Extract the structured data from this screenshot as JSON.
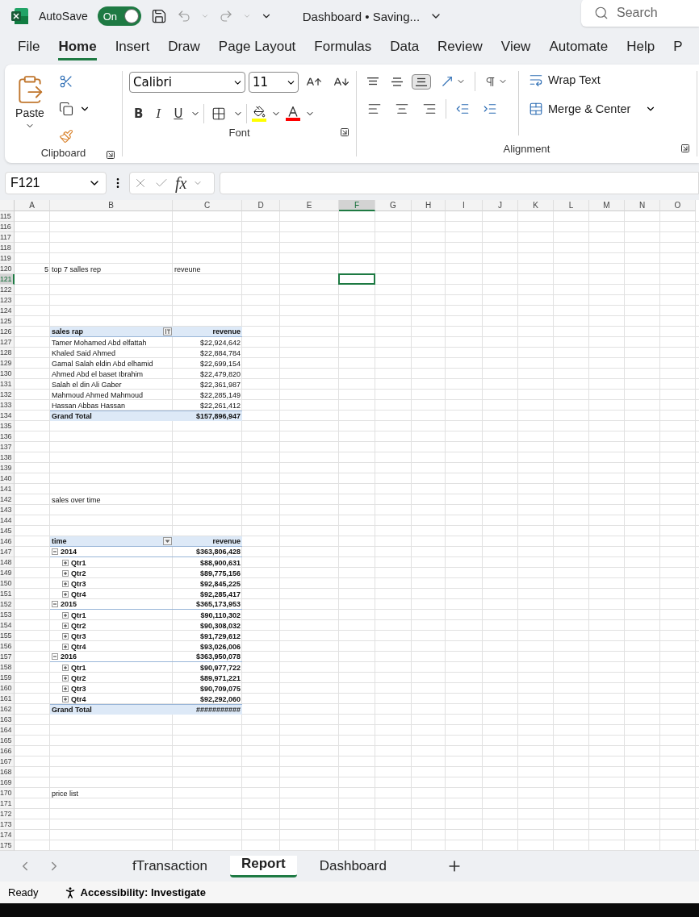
{
  "title_bar": {
    "autosave_label": "AutoSave",
    "autosave": {
      "label": "On",
      "on": true
    },
    "title": "Dashboard • Saving...",
    "search_placeholder": "Search"
  },
  "ribbon_tabs": [
    {
      "label": "File",
      "selected": false
    },
    {
      "label": "Home",
      "selected": true
    },
    {
      "label": "Insert",
      "selected": false
    },
    {
      "label": "Draw",
      "selected": false
    },
    {
      "label": "Page Layout",
      "selected": false
    },
    {
      "label": "Formulas",
      "selected": false
    },
    {
      "label": "Data",
      "selected": false
    },
    {
      "label": "Review",
      "selected": false
    },
    {
      "label": "View",
      "selected": false
    },
    {
      "label": "Automate",
      "selected": false
    },
    {
      "label": "Help",
      "selected": false
    },
    {
      "label": "P",
      "selected": false
    }
  ],
  "ribbon": {
    "paste_label": "Paste",
    "font_name": "Calibri",
    "font_size": "11",
    "format_buttons": [
      "B",
      "I",
      "U"
    ],
    "vertical_align": [
      {
        "kind": "top",
        "selected": false
      },
      {
        "kind": "middle",
        "selected": false
      },
      {
        "kind": "bottom",
        "selected": true
      }
    ],
    "wrap_text": "Wrap Text",
    "merge": "Merge & Center",
    "groups": [
      {
        "label": "Clipboard"
      },
      {
        "label": "Font"
      },
      {
        "label": "Alignment"
      }
    ]
  },
  "formula_bar": {
    "name_box": "F121",
    "function_label": "fx"
  },
  "columns": [
    {
      "label": "A",
      "selected": false
    },
    {
      "label": "B",
      "selected": false
    },
    {
      "label": "C",
      "selected": false
    },
    {
      "label": "D",
      "selected": false
    },
    {
      "label": "E",
      "selected": false
    },
    {
      "label": "F",
      "selected": true
    },
    {
      "label": "G",
      "selected": false
    },
    {
      "label": "H",
      "selected": false
    },
    {
      "label": "I",
      "selected": false
    },
    {
      "label": "J",
      "selected": false
    },
    {
      "label": "K",
      "selected": false
    },
    {
      "label": "L",
      "selected": false
    },
    {
      "label": "M",
      "selected": false
    },
    {
      "label": "N",
      "selected": false
    },
    {
      "label": "O",
      "selected": false
    }
  ],
  "rows": [
    {
      "number": "115",
      "kind": "plain",
      "selected": false
    },
    {
      "number": "116",
      "kind": "plain",
      "selected": false
    },
    {
      "number": "117",
      "kind": "plain",
      "selected": false
    },
    {
      "number": "118",
      "kind": "plain",
      "selected": false
    },
    {
      "number": "119",
      "kind": "plain",
      "selected": false
    },
    {
      "number": "120",
      "kind": "plain",
      "selected": false,
      "a": "5",
      "b": "top 7 salles rep",
      "c": "reveune"
    },
    {
      "number": "121",
      "kind": "plain",
      "selected": true
    },
    {
      "number": "122",
      "kind": "plain",
      "selected": false
    },
    {
      "number": "123",
      "kind": "plain",
      "selected": false
    },
    {
      "number": "124",
      "kind": "plain",
      "selected": false
    },
    {
      "number": "125",
      "kind": "plain",
      "selected": false
    },
    {
      "number": "126",
      "kind": "pivot_header",
      "selected": false,
      "label": "sales rap",
      "value": "revenue",
      "filter": {
        "kind": "sorted"
      }
    },
    {
      "number": "127",
      "kind": "pivot_item",
      "selected": false,
      "label": "Tamer Mohamed Abd elfattah",
      "value": "$22,924,642"
    },
    {
      "number": "128",
      "kind": "pivot_item",
      "selected": false,
      "label": "Khaled Said Ahmed",
      "value": "$22,884,784"
    },
    {
      "number": "129",
      "kind": "pivot_item",
      "selected": false,
      "label": "Gamal Salah eldin Abd elhamid",
      "value": "$22,699,154"
    },
    {
      "number": "130",
      "kind": "pivot_item",
      "selected": false,
      "label": "Ahmed Abd el baset Ibrahim",
      "value": "$22,479,820"
    },
    {
      "number": "131",
      "kind": "pivot_item",
      "selected": false,
      "label": "Salah el din Ali Gaber",
      "value": "$22,361,987"
    },
    {
      "number": "132",
      "kind": "pivot_item",
      "selected": false,
      "label": "Mahmoud Ahmed Mahmoud",
      "value": "$22,285,149"
    },
    {
      "number": "133",
      "kind": "pivot_item",
      "selected": false,
      "label": "Hassan Abbas Hassan",
      "value": "$22,261,412"
    },
    {
      "number": "134",
      "kind": "pivot_total",
      "selected": false,
      "label": "Grand Total",
      "value": "$157,896,947"
    },
    {
      "number": "135",
      "kind": "plain",
      "selected": false
    },
    {
      "number": "136",
      "kind": "plain",
      "selected": false
    },
    {
      "number": "137",
      "kind": "plain",
      "selected": false
    },
    {
      "number": "138",
      "kind": "plain",
      "selected": false
    },
    {
      "number": "139",
      "kind": "plain",
      "selected": false
    },
    {
      "number": "140",
      "kind": "plain",
      "selected": false
    },
    {
      "number": "141",
      "kind": "plain",
      "selected": false
    },
    {
      "number": "142",
      "kind": "plain",
      "selected": false,
      "b": "sales over time"
    },
    {
      "number": "143",
      "kind": "plain",
      "selected": false
    },
    {
      "number": "144",
      "kind": "plain",
      "selected": false
    },
    {
      "number": "145",
      "kind": "plain",
      "selected": false
    },
    {
      "number": "146",
      "kind": "pivot_header",
      "selected": false,
      "label": "time",
      "value": "revenue",
      "filter": {
        "kind": "dropdown"
      }
    },
    {
      "number": "147",
      "kind": "pivot_group",
      "selected": false,
      "label": "2014",
      "value": "$363,806,428",
      "expanded": true,
      "children": [
        {
          "number": "148",
          "label": "Qtr1",
          "value": "$88,900,631",
          "expanded": false,
          "selected": false
        },
        {
          "number": "149",
          "label": "Qtr2",
          "value": "$89,775,156",
          "expanded": false,
          "selected": false
        },
        {
          "number": "150",
          "label": "Qtr3",
          "value": "$92,845,225",
          "expanded": false,
          "selected": false
        },
        {
          "number": "151",
          "label": "Qtr4",
          "value": "$92,285,417",
          "expanded": false,
          "selected": false
        }
      ]
    },
    {
      "number": "152",
      "kind": "pivot_group",
      "selected": false,
      "label": "2015",
      "value": "$365,173,953",
      "expanded": true,
      "children": [
        {
          "number": "153",
          "label": "Qtr1",
          "value": "$90,110,302",
          "expanded": false,
          "selected": false
        },
        {
          "number": "154",
          "label": "Qtr2",
          "value": "$90,308,032",
          "expanded": false,
          "selected": false
        },
        {
          "number": "155",
          "label": "Qtr3",
          "value": "$91,729,612",
          "expanded": false,
          "selected": false
        },
        {
          "number": "156",
          "label": "Qtr4",
          "value": "$93,026,006",
          "expanded": false,
          "selected": false
        }
      ]
    },
    {
      "number": "157",
      "kind": "pivot_group",
      "selected": false,
      "label": "2016",
      "value": "$363,950,078",
      "expanded": true,
      "children": [
        {
          "number": "158",
          "label": "Qtr1",
          "value": "$90,977,722",
          "expanded": false,
          "selected": false
        },
        {
          "number": "159",
          "label": "Qtr2",
          "value": "$89,971,221",
          "expanded": false,
          "selected": false
        },
        {
          "number": "160",
          "label": "Qtr3",
          "value": "$90,709,075",
          "expanded": false,
          "selected": false
        },
        {
          "number": "161",
          "label": "Qtr4",
          "value": "$92,292,060",
          "expanded": false,
          "selected": false
        }
      ]
    },
    {
      "number": "162",
      "kind": "pivot_total",
      "selected": false,
      "label": "Grand Total",
      "value": "###########"
    },
    {
      "number": "163",
      "kind": "plain",
      "selected": false
    },
    {
      "number": "164",
      "kind": "plain",
      "selected": false
    },
    {
      "number": "165",
      "kind": "plain",
      "selected": false
    },
    {
      "number": "166",
      "kind": "plain",
      "selected": false
    },
    {
      "number": "167",
      "kind": "plain",
      "selected": false
    },
    {
      "number": "168",
      "kind": "plain",
      "selected": false
    },
    {
      "number": "169",
      "kind": "plain",
      "selected": false
    },
    {
      "number": "170",
      "kind": "plain",
      "selected": false,
      "b": "price list"
    },
    {
      "number": "171",
      "kind": "plain",
      "selected": false
    },
    {
      "number": "172",
      "kind": "plain",
      "selected": false
    },
    {
      "number": "173",
      "kind": "plain",
      "selected": false
    },
    {
      "number": "174",
      "kind": "plain",
      "selected": false
    },
    {
      "number": "175",
      "kind": "plain",
      "selected": false
    }
  ],
  "sheet_tabs": [
    {
      "label": "fTransaction",
      "selected": false
    },
    {
      "label": "Report",
      "selected": true
    },
    {
      "label": "Dashboard",
      "selected": false
    }
  ],
  "status_bar": {
    "mode": "Ready",
    "accessibility": "Accessibility: Investigate"
  }
}
